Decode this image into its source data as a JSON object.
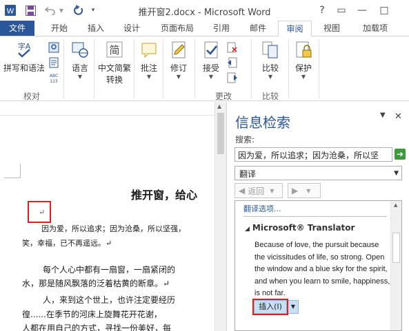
{
  "window": {
    "title": "推开窗2.docx - Microsoft Word",
    "help": "?",
    "controls": [
      "▭",
      "—",
      "□"
    ]
  },
  "tabs": [
    "文件",
    "开始",
    "插入",
    "设计",
    "页面布局",
    "引用",
    "邮件",
    "审阅",
    "视图",
    "加载项"
  ],
  "active_tab": "审阅",
  "ribbon": {
    "proofing": {
      "spelling": "拼写和语法",
      "group": "校对"
    },
    "language": "语言",
    "chinese_conversion": [
      "中文简繁",
      "转换"
    ],
    "comments": "批注",
    "tracking": "修订",
    "changes": {
      "accept": "接受",
      "group": "更改"
    },
    "compare": {
      "label": "比较",
      "group": "比较"
    },
    "protect": "保护"
  },
  "document": {
    "title": "推开窗，给心",
    "para_mark": "↵",
    "lines": [
      "因为爱，所以追求；因为沧桑，所以坚强，",
      "笑，幸福，已不再遥远。↵",
      "每个人心中都有一扇窗，一扇紧闭的",
      "水，那是随风飘落的泛着枯黄的断章。↵",
      "人，来到这个世上，也许注定要经历",
      "徨......在季节的河床上旋舞花开花谢，",
      "人都在用自己的方式，寻找一份美好，每"
    ]
  },
  "research_pane": {
    "title": "信息检索",
    "search_label": "搜索:",
    "search_value": "因为爱，所以追求；因为沧桑，所以坚",
    "service": "翻译",
    "back": "返回",
    "options_link": "翻译选项...",
    "translator_name": "Microsoft® Translator",
    "translation": "Because of love, the pursuit because the vicissitudes of life, so strong. Open the window and a blue sky for the spirit, and when you learn to smile, happiness, is not far.",
    "insert_button": "插入(I)"
  },
  "colors": {
    "accent": "#2b579a",
    "highlight": "#e02020"
  }
}
